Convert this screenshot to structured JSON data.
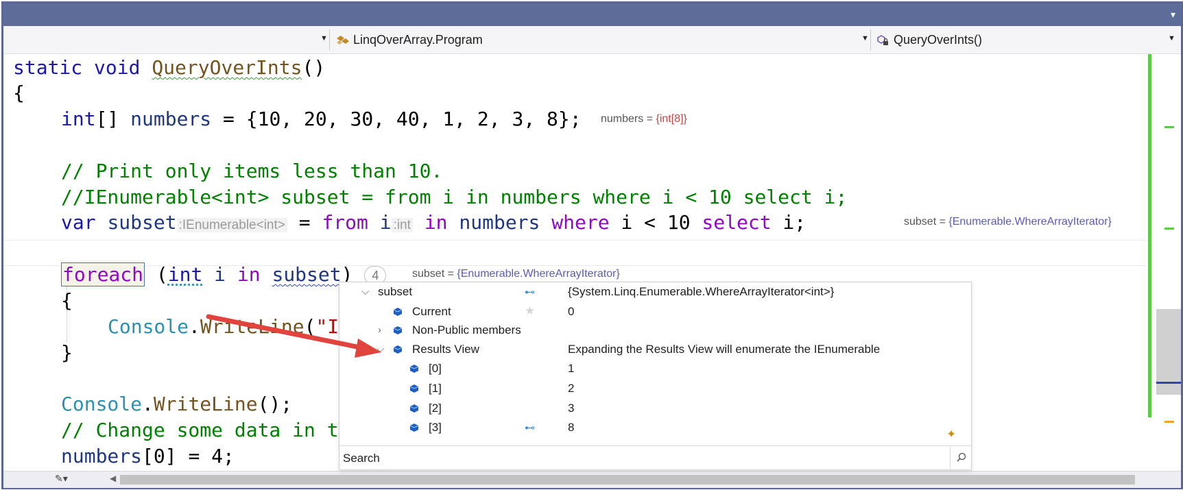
{
  "navbar": {
    "class_combo": "LinqOverArray.Program",
    "member_combo": "QueryOverInts()"
  },
  "code": {
    "l1_kw1": "static",
    "l1_kw2": "void",
    "l1_method": "QueryOverInts",
    "l1_rest": "()",
    "l2": "{",
    "l3_type": "int",
    "l3_rest1": "[] ",
    "l3_var": "numbers",
    "l3_rest2": " = {10, 20, 30, 40, 1, 2, 3, 8};",
    "l3_tip_name": "numbers = ",
    "l3_tip_val": "{int[8]}",
    "l5": "// Print only items less than 10.",
    "l6": "//IEnumerable<int> subset = from i in numbers where i < 10 select i;",
    "l7_var": "var",
    "l7_name": "subset",
    "l7_hint": ":IEnumerable<int>",
    "l7_eq": " = ",
    "l7_from": "from",
    "l7_i": " i",
    "l7_hint2": ":int",
    "l7_in": "in",
    "l7_numbers": "numbers",
    "l7_where": "where",
    "l7_i2": " i < 10 ",
    "l7_select": "select",
    "l7_end": " i;",
    "l7_tip_name": "subset = ",
    "l7_tip_val": "{Enumerable.WhereArrayIterator}",
    "l9_foreach": "foreach",
    "l9_open": " (",
    "l9_int": "int",
    "l9_i": " i ",
    "l9_in": "in",
    "l9_subset": "subset",
    "l9_close": ")",
    "l9_badge": "4",
    "l9_tip_name": "subset = ",
    "l9_tip_val": "{Enumerable.WhereArrayIterator}",
    "l10": "{",
    "l11_console": "Console",
    "l11_dot": ".",
    "l11_method": "WriteLine",
    "l11_paren": "(",
    "l11_str": "\"I",
    "l12": "}",
    "l14_console": "Console",
    "l14_dot": ".",
    "l14_method": "WriteLine",
    "l14_rest": "();",
    "l15": "// Change some data in t",
    "l16_var": "numbers",
    "l16_rest": "[0] = 4;"
  },
  "datatip": {
    "rows": [
      {
        "name": "subset",
        "value": "{System.Linq.Enumerable.WhereArrayIterator<int>}"
      },
      {
        "name": "Current",
        "value": "0"
      },
      {
        "name": "Non-Public members",
        "value": ""
      },
      {
        "name": "Results View",
        "value": "Expanding the Results View will enumerate the IEnumerable"
      },
      {
        "name": "[0]",
        "value": "1"
      },
      {
        "name": "[1]",
        "value": "2"
      },
      {
        "name": "[2]",
        "value": "3"
      },
      {
        "name": "[3]",
        "value": "8"
      }
    ],
    "search_label": "Search"
  },
  "colors": {
    "titlebar": "#5d6c98",
    "arrow": "#e0443c",
    "change_bar": "#5cc94a"
  }
}
